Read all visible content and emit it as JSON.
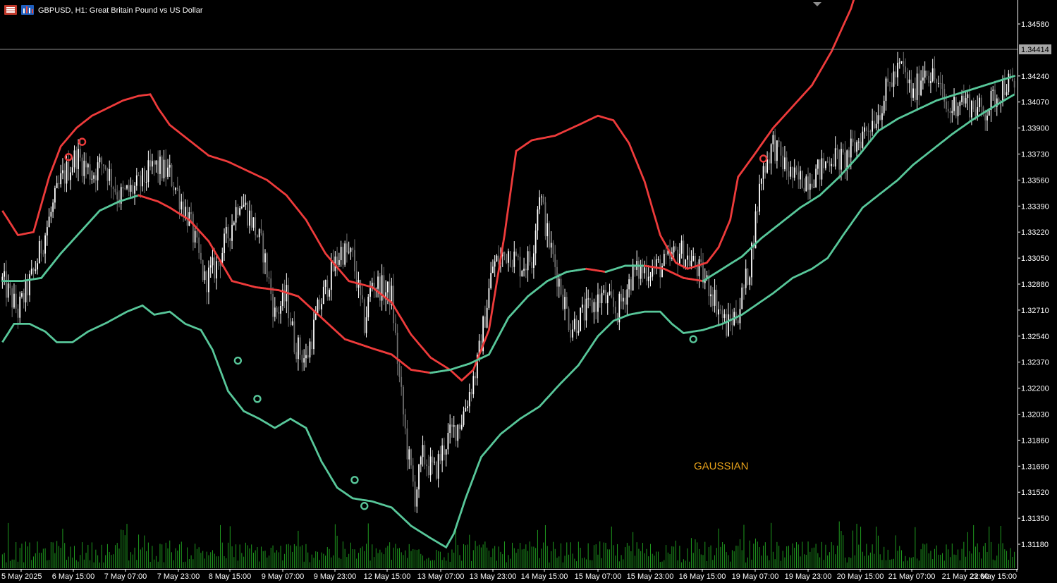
{
  "header": {
    "symbol_title": "GBPUSD, H1:  Great Britain Pound vs US Dollar",
    "icons": [
      "chart-menu-icon",
      "bar-chart-icon"
    ]
  },
  "watermark": "GAUSSIAN",
  "current_price_label": "1.34414",
  "colors": {
    "background": "#000000",
    "bull_candle": "#ffffff",
    "bear_candle": "#6e6e6e",
    "upper_band": "#ee3b3b",
    "lower_band": "#58c79a",
    "volume": "#1f9b1f",
    "axis": "#ffffff",
    "watermark": "#e5a01a"
  },
  "chart_data": {
    "type": "candlestick",
    "title": "GBPUSD, H1:  Great Britain Pound vs US Dollar",
    "ylim": [
      1.311,
      1.347
    ],
    "current_price": 1.34414,
    "y_ticks": [
      "1.34580",
      "1.34240",
      "1.34070",
      "1.33900",
      "1.33730",
      "1.33560",
      "1.33390",
      "1.33220",
      "1.33050",
      "1.32880",
      "1.32710",
      "1.32540",
      "1.32370",
      "1.32200",
      "1.32030",
      "1.31860",
      "1.31690",
      "1.31520",
      "1.31350",
      "1.31180"
    ],
    "x_ticks": [
      "5 May 2025",
      "6 May 15:00",
      "7 May 07:00",
      "7 May 23:00",
      "8 May 15:00",
      "9 May 07:00",
      "9 May 23:00",
      "12 May 15:00",
      "13 May 07:00",
      "13 May 23:00",
      "14 May 15:00",
      "15 May 07:00",
      "15 May 23:00",
      "16 May 15:00",
      "19 May 07:00",
      "19 May 23:00",
      "20 May 15:00",
      "21 May 07:00",
      "21 May 23:00",
      "22 May 15:00"
    ],
    "close_path": [
      [
        0,
        1.329
      ],
      [
        8,
        1.327
      ],
      [
        16,
        1.3295
      ],
      [
        24,
        1.333
      ],
      [
        30,
        1.3355
      ],
      [
        38,
        1.3372
      ],
      [
        46,
        1.336
      ],
      [
        52,
        1.3368
      ],
      [
        60,
        1.3345
      ],
      [
        70,
        1.3352
      ],
      [
        78,
        1.3365
      ],
      [
        86,
        1.336
      ],
      [
        96,
        1.333
      ],
      [
        104,
        1.329
      ],
      [
        110,
        1.33
      ],
      [
        116,
        1.332
      ],
      [
        122,
        1.3345
      ],
      [
        128,
        1.333
      ],
      [
        134,
        1.331
      ],
      [
        140,
        1.3268
      ],
      [
        146,
        1.328
      ],
      [
        150,
        1.325
      ],
      [
        156,
        1.3238
      ],
      [
        162,
        1.327
      ],
      [
        168,
        1.3292
      ],
      [
        174,
        1.331
      ],
      [
        180,
        1.3305
      ],
      [
        186,
        1.3262
      ],
      [
        190,
        1.329
      ],
      [
        200,
        1.328
      ],
      [
        204,
        1.3225
      ],
      [
        208,
        1.318
      ],
      [
        212,
        1.315
      ],
      [
        216,
        1.3175
      ],
      [
        222,
        1.3165
      ],
      [
        228,
        1.3185
      ],
      [
        236,
        1.32
      ],
      [
        244,
        1.3235
      ],
      [
        252,
        1.33
      ],
      [
        260,
        1.331
      ],
      [
        266,
        1.33
      ],
      [
        272,
        1.3305
      ],
      [
        276,
        1.335
      ],
      [
        280,
        1.332
      ],
      [
        286,
        1.329
      ],
      [
        292,
        1.326
      ],
      [
        300,
        1.327
      ],
      [
        308,
        1.328
      ],
      [
        316,
        1.327
      ],
      [
        324,
        1.3295
      ],
      [
        332,
        1.3298
      ],
      [
        340,
        1.33
      ],
      [
        348,
        1.331
      ],
      [
        356,
        1.33
      ],
      [
        364,
        1.3285
      ],
      [
        372,
        1.326
      ],
      [
        378,
        1.327
      ],
      [
        384,
        1.33
      ],
      [
        390,
        1.336
      ],
      [
        396,
        1.338
      ],
      [
        402,
        1.3365
      ],
      [
        408,
        1.3355
      ],
      [
        414,
        1.3358
      ],
      [
        420,
        1.3362
      ],
      [
        426,
        1.3372
      ],
      [
        432,
        1.3368
      ],
      [
        438,
        1.3378
      ],
      [
        444,
        1.339
      ],
      [
        450,
        1.34
      ],
      [
        456,
        1.342
      ],
      [
        462,
        1.343
      ],
      [
        468,
        1.341
      ],
      [
        474,
        1.343
      ],
      [
        480,
        1.342
      ],
      [
        486,
        1.34
      ],
      [
        492,
        1.341
      ],
      [
        498,
        1.3405
      ],
      [
        504,
        1.34
      ],
      [
        510,
        1.341
      ],
      [
        516,
        1.342
      ],
      [
        520,
        1.3415
      ]
    ],
    "upper_band": [
      [
        0,
        1.3336
      ],
      [
        8,
        1.332
      ],
      [
        16,
        1.3322
      ],
      [
        24,
        1.3358
      ],
      [
        30,
        1.3378
      ],
      [
        38,
        1.339
      ],
      [
        46,
        1.3398
      ],
      [
        54,
        1.3403
      ],
      [
        62,
        1.3408
      ],
      [
        70,
        1.3411
      ],
      [
        76,
        1.3412
      ],
      [
        80,
        1.3403
      ],
      [
        86,
        1.3392
      ],
      [
        96,
        1.3382
      ],
      [
        106,
        1.3372
      ],
      [
        116,
        1.3368
      ],
      [
        126,
        1.3362
      ],
      [
        136,
        1.3356
      ],
      [
        146,
        1.3346
      ],
      [
        156,
        1.333
      ],
      [
        166,
        1.3308
      ],
      [
        178,
        1.329
      ],
      [
        190,
        1.3286
      ],
      [
        200,
        1.3276
      ],
      [
        210,
        1.3255
      ],
      [
        220,
        1.324
      ],
      [
        230,
        1.3232
      ],
      [
        236,
        1.3225
      ],
      [
        242,
        1.3232
      ],
      [
        250,
        1.3258
      ],
      [
        258,
        1.332
      ],
      [
        264,
        1.3375
      ],
      [
        272,
        1.3382
      ],
      [
        284,
        1.3385
      ],
      [
        296,
        1.3392
      ],
      [
        306,
        1.3398
      ],
      [
        314,
        1.3395
      ],
      [
        322,
        1.338
      ],
      [
        330,
        1.3355
      ],
      [
        338,
        1.332
      ],
      [
        346,
        1.3302
      ],
      [
        352,
        1.3298
      ],
      [
        362,
        1.3302
      ],
      [
        368,
        1.3312
      ],
      [
        374,
        1.333
      ],
      [
        378,
        1.3358
      ],
      [
        386,
        1.3372
      ],
      [
        396,
        1.339
      ],
      [
        406,
        1.3404
      ],
      [
        416,
        1.3418
      ],
      [
        426,
        1.344
      ],
      [
        436,
        1.3468
      ],
      [
        444,
        1.35
      ],
      [
        450,
        1.3535
      ],
      [
        458,
        1.356
      ],
      [
        466,
        1.3575
      ],
      [
        474,
        1.3588
      ],
      [
        484,
        1.36
      ],
      [
        494,
        1.3612
      ],
      [
        504,
        1.362
      ],
      [
        520,
        1.363
      ]
    ],
    "lower_band": [
      [
        0,
        1.325
      ],
      [
        6,
        1.3262
      ],
      [
        14,
        1.3262
      ],
      [
        22,
        1.3257
      ],
      [
        28,
        1.325
      ],
      [
        36,
        1.325
      ],
      [
        44,
        1.3257
      ],
      [
        54,
        1.3263
      ],
      [
        64,
        1.327
      ],
      [
        72,
        1.3274
      ],
      [
        78,
        1.3268
      ],
      [
        86,
        1.327
      ],
      [
        94,
        1.3262
      ],
      [
        102,
        1.3258
      ],
      [
        108,
        1.3245
      ],
      [
        116,
        1.3218
      ],
      [
        124,
        1.3205
      ],
      [
        132,
        1.32
      ],
      [
        140,
        1.3194
      ],
      [
        148,
        1.32
      ],
      [
        156,
        1.3194
      ],
      [
        164,
        1.3172
      ],
      [
        172,
        1.3155
      ],
      [
        180,
        1.3148
      ],
      [
        190,
        1.3146
      ],
      [
        200,
        1.3142
      ],
      [
        210,
        1.313
      ],
      [
        220,
        1.3122
      ],
      [
        228,
        1.3116
      ],
      [
        232,
        1.3125
      ],
      [
        238,
        1.3148
      ],
      [
        246,
        1.3175
      ],
      [
        256,
        1.319
      ],
      [
        266,
        1.32
      ],
      [
        276,
        1.3208
      ],
      [
        286,
        1.3222
      ],
      [
        296,
        1.3235
      ],
      [
        306,
        1.3254
      ],
      [
        314,
        1.3264
      ],
      [
        322,
        1.3268
      ],
      [
        330,
        1.327
      ],
      [
        338,
        1.327
      ],
      [
        344,
        1.3262
      ],
      [
        350,
        1.3256
      ],
      [
        360,
        1.3258
      ],
      [
        370,
        1.3262
      ],
      [
        380,
        1.3268
      ],
      [
        388,
        1.3275
      ],
      [
        396,
        1.3282
      ],
      [
        406,
        1.3292
      ],
      [
        416,
        1.3298
      ],
      [
        424,
        1.3305
      ],
      [
        432,
        1.332
      ],
      [
        442,
        1.3338
      ],
      [
        452,
        1.3348
      ],
      [
        460,
        1.3356
      ],
      [
        468,
        1.3366
      ],
      [
        478,
        1.3376
      ],
      [
        488,
        1.3386
      ],
      [
        498,
        1.3395
      ],
      [
        508,
        1.3403
      ],
      [
        520,
        1.3412
      ]
    ],
    "mid_band": [
      [
        0,
        1.329
      ],
      [
        10,
        1.329
      ],
      [
        20,
        1.3292
      ],
      [
        30,
        1.3308
      ],
      [
        40,
        1.3322
      ],
      [
        50,
        1.3336
      ],
      [
        60,
        1.3342
      ],
      [
        70,
        1.3346
      ],
      [
        80,
        1.3342
      ],
      [
        86,
        1.3338
      ],
      [
        96,
        1.333
      ],
      [
        106,
        1.3316
      ],
      [
        118,
        1.329
      ],
      [
        130,
        1.3286
      ],
      [
        142,
        1.3284
      ],
      [
        152,
        1.328
      ],
      [
        164,
        1.3266
      ],
      [
        176,
        1.3252
      ],
      [
        190,
        1.3246
      ],
      [
        200,
        1.3242
      ],
      [
        210,
        1.3232
      ],
      [
        220,
        1.323
      ],
      [
        230,
        1.3232
      ],
      [
        240,
        1.3236
      ],
      [
        250,
        1.3242
      ],
      [
        260,
        1.3266
      ],
      [
        270,
        1.328
      ],
      [
        280,
        1.329
      ],
      [
        290,
        1.3296
      ],
      [
        300,
        1.3298
      ],
      [
        310,
        1.3296
      ],
      [
        320,
        1.33
      ],
      [
        330,
        1.33
      ],
      [
        340,
        1.3298
      ],
      [
        350,
        1.3292
      ],
      [
        360,
        1.329
      ],
      [
        370,
        1.3298
      ],
      [
        380,
        1.3306
      ],
      [
        390,
        1.3318
      ],
      [
        400,
        1.3328
      ],
      [
        410,
        1.3338
      ],
      [
        420,
        1.3346
      ],
      [
        430,
        1.3358
      ],
      [
        440,
        1.3372
      ],
      [
        450,
        1.3388
      ],
      [
        460,
        1.3396
      ],
      [
        470,
        1.3402
      ],
      [
        480,
        1.3408
      ],
      [
        490,
        1.3412
      ],
      [
        500,
        1.3416
      ],
      [
        510,
        1.342
      ],
      [
        520,
        1.3424
      ]
    ],
    "signals": [
      {
        "type": "sell",
        "i": 34,
        "price": 1.3371
      },
      {
        "type": "sell",
        "i": 41,
        "price": 1.3381
      },
      {
        "type": "buy",
        "i": 121,
        "price": 1.3238
      },
      {
        "type": "buy",
        "i": 131,
        "price": 1.3213
      },
      {
        "type": "buy",
        "i": 181,
        "price": 1.316
      },
      {
        "type": "buy",
        "i": 186,
        "price": 1.3143
      },
      {
        "type": "buy",
        "i": 355,
        "price": 1.3252
      },
      {
        "type": "sell",
        "i": 391,
        "price": 1.337
      }
    ]
  }
}
